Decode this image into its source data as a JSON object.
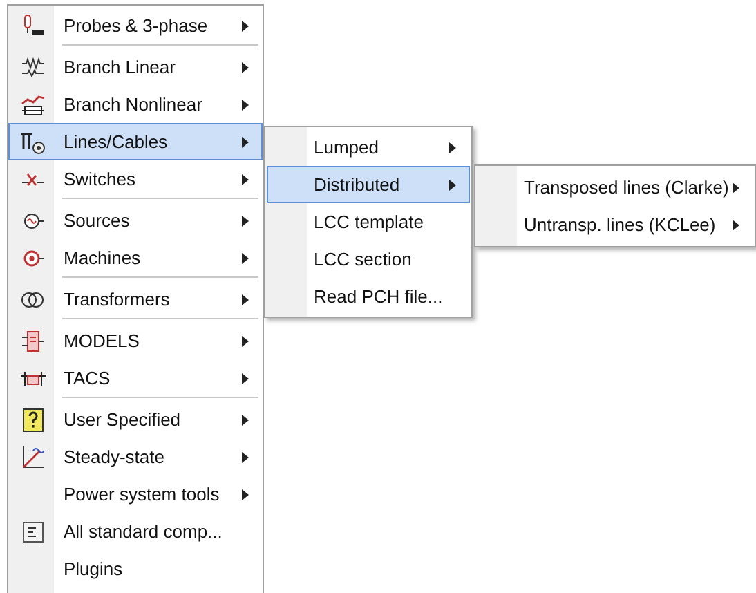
{
  "menu": {
    "items": [
      {
        "label": "Probes & 3-phase",
        "has_submenu": true,
        "selected": false,
        "separator_after": true
      },
      {
        "label": "Branch Linear",
        "has_submenu": true,
        "selected": false,
        "separator_after": false
      },
      {
        "label": "Branch Nonlinear",
        "has_submenu": true,
        "selected": false,
        "separator_after": false
      },
      {
        "label": "Lines/Cables",
        "has_submenu": true,
        "selected": true,
        "separator_after": false
      },
      {
        "label": "Switches",
        "has_submenu": true,
        "selected": false,
        "separator_after": true
      },
      {
        "label": "Sources",
        "has_submenu": true,
        "selected": false,
        "separator_after": false
      },
      {
        "label": "Machines",
        "has_submenu": true,
        "selected": false,
        "separator_after": true
      },
      {
        "label": "Transformers",
        "has_submenu": true,
        "selected": false,
        "separator_after": true
      },
      {
        "label": "MODELS",
        "has_submenu": true,
        "selected": false,
        "separator_after": false
      },
      {
        "label": "TACS",
        "has_submenu": true,
        "selected": false,
        "separator_after": true
      },
      {
        "label": "User Specified",
        "has_submenu": true,
        "selected": false,
        "separator_after": false
      },
      {
        "label": "Steady-state",
        "has_submenu": true,
        "selected": false,
        "separator_after": false
      },
      {
        "label": "Power system tools",
        "has_submenu": true,
        "selected": false,
        "separator_after": false
      },
      {
        "label": "All standard comp...",
        "has_submenu": false,
        "selected": false,
        "separator_after": false
      },
      {
        "label": "Plugins",
        "has_submenu": false,
        "selected": false,
        "separator_after": false
      }
    ]
  },
  "submenu": {
    "items": [
      {
        "label": "Lumped",
        "has_submenu": true,
        "selected": false
      },
      {
        "label": "Distributed",
        "has_submenu": true,
        "selected": true
      },
      {
        "label": "LCC template",
        "has_submenu": false,
        "selected": false
      },
      {
        "label": "LCC section",
        "has_submenu": false,
        "selected": false
      },
      {
        "label": "Read PCH file...",
        "has_submenu": false,
        "selected": false
      }
    ]
  },
  "submenu_2": {
    "items": [
      {
        "label": "Transposed lines (Clarke)",
        "has_submenu": true,
        "selected": false
      },
      {
        "label": "Untransp. lines (KCLee)",
        "has_submenu": true,
        "selected": false
      }
    ]
  }
}
